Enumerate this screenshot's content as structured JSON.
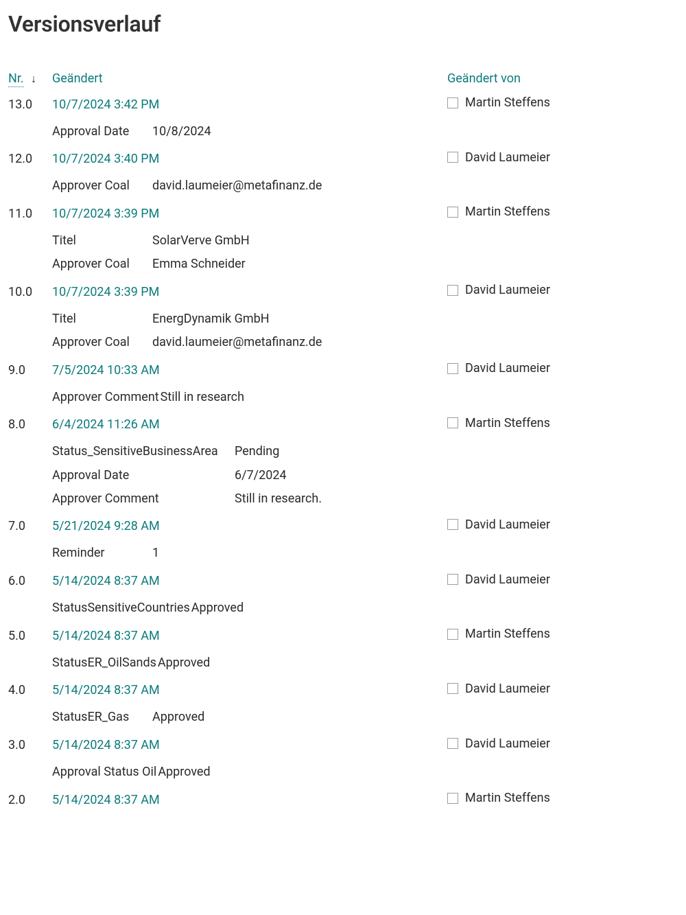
{
  "title": "Versionsverlauf",
  "headers": {
    "nr": "Nr.",
    "modified": "Geändert",
    "modified_by": "Geändert von"
  },
  "versions": [
    {
      "nr": "13.0",
      "datetime": "10/7/2024 3:42 PM",
      "user": "Martin Steffens",
      "fields": [
        {
          "label": "Approval Date",
          "value": "10/8/2024"
        }
      ],
      "layout": "std"
    },
    {
      "nr": "12.0",
      "datetime": "10/7/2024 3:40 PM",
      "user": "David Laumeier",
      "fields": [
        {
          "label": "Approver Coal",
          "value": "david.laumeier@metafinanz.de"
        }
      ],
      "layout": "std"
    },
    {
      "nr": "11.0",
      "datetime": "10/7/2024 3:39 PM",
      "user": "Martin Steffens",
      "fields": [
        {
          "label": "Titel",
          "value": "SolarVerve GmbH"
        },
        {
          "label": "Approver Coal",
          "value": "Emma Schneider"
        }
      ],
      "layout": "std"
    },
    {
      "nr": "10.0",
      "datetime": "10/7/2024 3:39 PM",
      "user": "David Laumeier",
      "fields": [
        {
          "label": "Titel",
          "value": "EnergDynamik GmbH"
        },
        {
          "label": "Approver Coal",
          "value": "david.laumeier@metafinanz.de"
        }
      ],
      "layout": "std"
    },
    {
      "nr": "9.0",
      "datetime": "7/5/2024 10:33 AM",
      "user": "David Laumeier",
      "fields": [
        {
          "label": "Approver Comment",
          "value": "Still in research"
        }
      ],
      "layout": "gap0"
    },
    {
      "nr": "8.0",
      "datetime": "6/4/2024 11:26 AM",
      "user": "Martin Steffens",
      "fields": [
        {
          "label": "Status_SensitiveBusinessArea",
          "value": "Pending"
        },
        {
          "label": "Approval Date",
          "value": "6/7/2024"
        },
        {
          "label": "Approver Comment",
          "value": "Still in research."
        }
      ],
      "layout": "wide"
    },
    {
      "nr": "7.0",
      "datetime": "5/21/2024 9:28 AM",
      "user": "David Laumeier",
      "fields": [
        {
          "label": "Reminder",
          "value": "1"
        }
      ],
      "layout": "std"
    },
    {
      "nr": "6.0",
      "datetime": "5/14/2024 8:37 AM",
      "user": "David Laumeier",
      "fields": [
        {
          "label": "StatusSensitiveCountries",
          "value": "Approved"
        }
      ],
      "layout": "gap0"
    },
    {
      "nr": "5.0",
      "datetime": "5/14/2024 8:37 AM",
      "user": "Martin Steffens",
      "fields": [
        {
          "label": "StatusER_OilSands",
          "value": "Approved"
        }
      ],
      "layout": "gap0"
    },
    {
      "nr": "4.0",
      "datetime": "5/14/2024 8:37 AM",
      "user": "David Laumeier",
      "fields": [
        {
          "label": "StatusER_Gas",
          "value": "Approved"
        }
      ],
      "layout": "std"
    },
    {
      "nr": "3.0",
      "datetime": "5/14/2024 8:37 AM",
      "user": "David Laumeier",
      "fields": [
        {
          "label": "Approval Status Oil",
          "value": "Approved"
        }
      ],
      "layout": "gap0"
    },
    {
      "nr": "2.0",
      "datetime": "5/14/2024 8:37 AM",
      "user": "Martin Steffens",
      "fields": [],
      "layout": "std"
    }
  ]
}
